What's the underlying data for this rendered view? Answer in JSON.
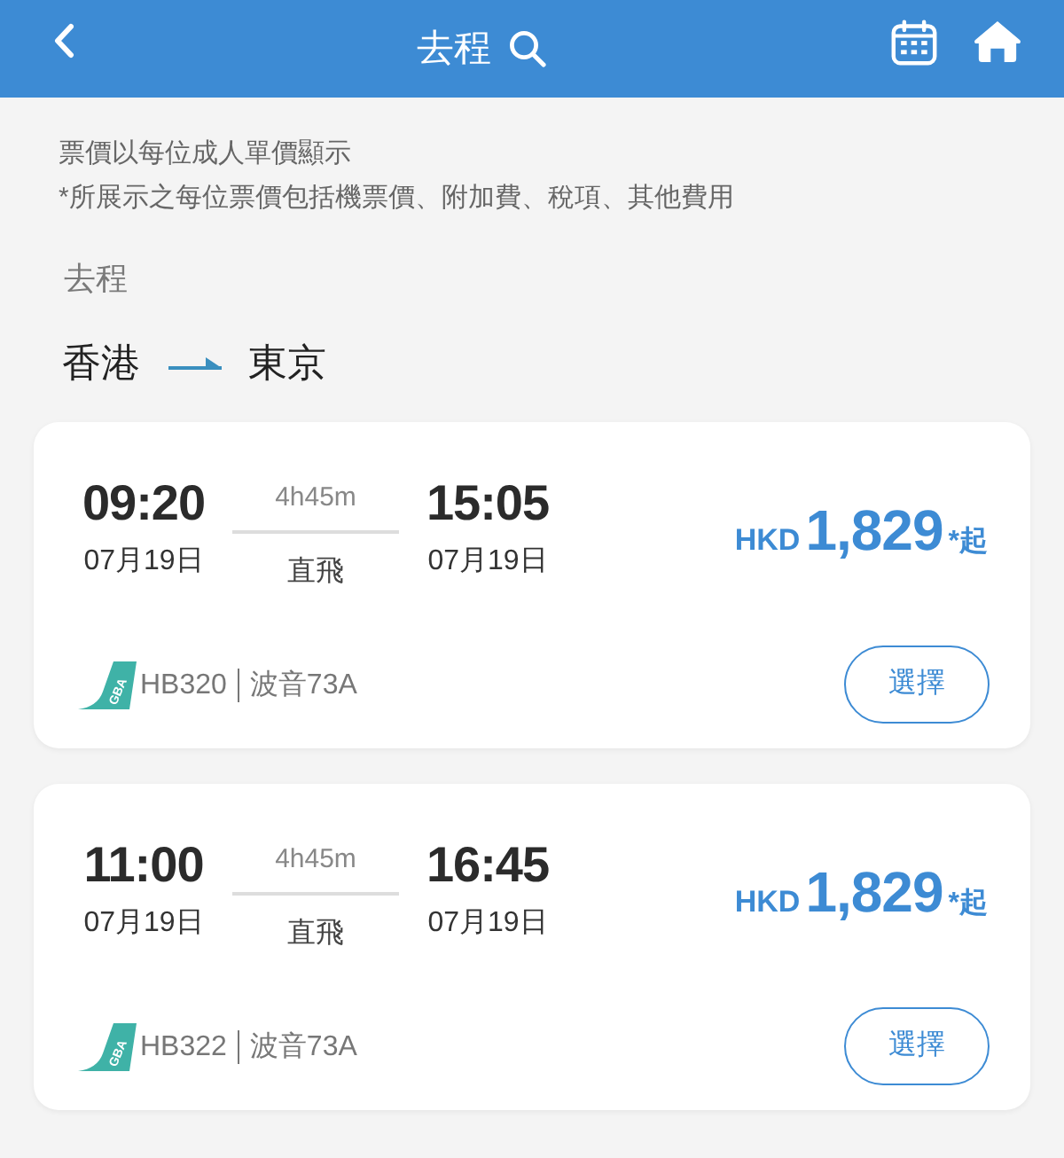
{
  "header": {
    "title": "去程"
  },
  "notices": [
    "票價以每位成人單價顯示",
    "*所展示之每位票價包括機票價、附加費、稅項、其他費用"
  ],
  "section_label": "去程",
  "route": {
    "origin": "香港",
    "destination": "東京"
  },
  "flights": [
    {
      "departure_time": "09:20",
      "departure_date": "07月19日",
      "duration": "4h45m",
      "stop_type": "直飛",
      "arrival_time": "15:05",
      "arrival_date": "07月19日",
      "currency": "HKD",
      "price": "1,829",
      "price_suffix": "*起",
      "logo_text": "GBA",
      "flight_number": "HB320",
      "aircraft": "波音73A",
      "button": "選擇"
    },
    {
      "departure_time": "11:00",
      "departure_date": "07月19日",
      "duration": "4h45m",
      "stop_type": "直飛",
      "arrival_time": "16:45",
      "arrival_date": "07月19日",
      "currency": "HKD",
      "price": "1,829",
      "price_suffix": "*起",
      "logo_text": "GBA",
      "flight_number": "HB322",
      "aircraft": "波音73A",
      "button": "選擇"
    }
  ]
}
